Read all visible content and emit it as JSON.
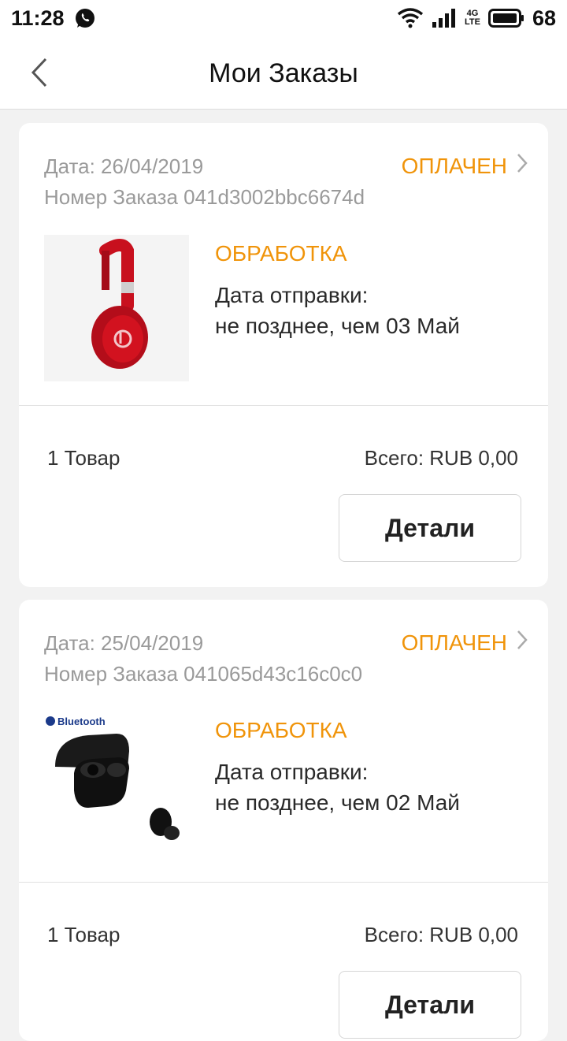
{
  "status_bar": {
    "time": "11:28",
    "network": [
      "4G",
      "LTE"
    ],
    "battery": "68"
  },
  "header": {
    "title": "Мои Заказы"
  },
  "orders": [
    {
      "date": "Дата: 26/04/2019",
      "number": "Номер Заказа 041d3002bbc6674d",
      "payment_status": "ОПЛАЧЕН",
      "image": "red-headphones",
      "processing_status": "ОБРАБОТКА",
      "ship_label": "Дата отправки:",
      "ship_date": "не позднее, чем 03 Май",
      "item_count": "1 Товар",
      "total": "Всего: RUB 0,00",
      "details_label": "Детали"
    },
    {
      "date": "Дата: 25/04/2019",
      "number": "Номер Заказа 041065d43c16c0c0",
      "payment_status": "ОПЛАЧЕН",
      "image": "bluetooth-earbuds",
      "image_caption": "Bluetooth",
      "processing_status": "ОБРАБОТКА",
      "ship_label": "Дата отправки:",
      "ship_date": "не позднее, чем 02 Май",
      "item_count": "1 Товар",
      "total": "Всего: RUB 0,00",
      "details_label": "Детали"
    }
  ],
  "colors": {
    "accent": "#f0940a",
    "muted_text": "#9a9a9a",
    "background": "#f2f2f2"
  }
}
